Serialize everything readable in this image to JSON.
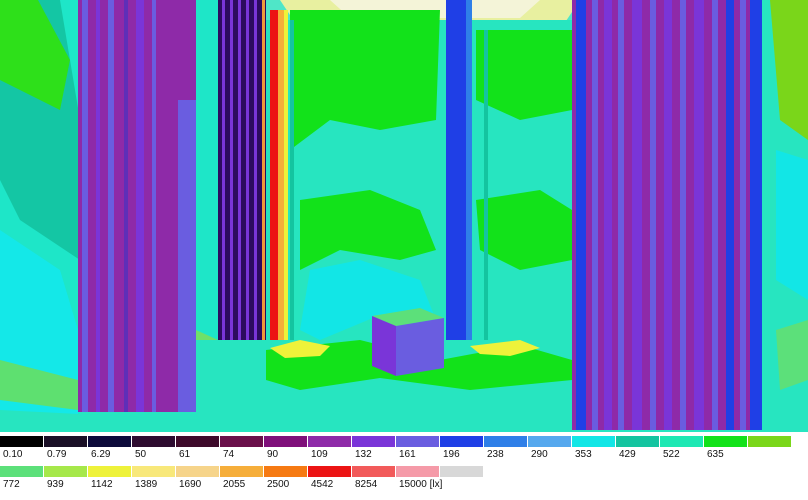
{
  "legend": {
    "row1": [
      {
        "label": "0.10",
        "color": "#000000"
      },
      {
        "label": "0.79",
        "color": "#1a0f26"
      },
      {
        "label": "6.29",
        "color": "#0c0a3a"
      },
      {
        "label": "50",
        "color": "#2d0b2f"
      },
      {
        "label": "61",
        "color": "#3e0a2a"
      },
      {
        "label": "74",
        "color": "#6a0f4a"
      },
      {
        "label": "90",
        "color": "#7f0f7a"
      },
      {
        "label": "109",
        "color": "#8e2aa8"
      },
      {
        "label": "132",
        "color": "#7a35d8"
      },
      {
        "label": "161",
        "color": "#6a5de0"
      },
      {
        "label": "196",
        "color": "#1f3fe6"
      },
      {
        "label": "238",
        "color": "#2f7fe8"
      },
      {
        "label": "290",
        "color": "#55a8ee"
      },
      {
        "label": "353",
        "color": "#12e6e6"
      },
      {
        "label": "429",
        "color": "#14c4a0"
      },
      {
        "label": "522",
        "color": "#1ee8b4"
      },
      {
        "label": "635",
        "color": "#12e21a"
      },
      {
        "label": "",
        "color": "#7ad61a"
      }
    ],
    "row2": [
      {
        "label": "772",
        "color": "#5ce07a"
      },
      {
        "label": "939",
        "color": "#a6e84a"
      },
      {
        "label": "1142",
        "color": "#eef23a"
      },
      {
        "label": "1389",
        "color": "#f8e87a"
      },
      {
        "label": "1690",
        "color": "#f6d48a"
      },
      {
        "label": "2055",
        "color": "#f6ae3a"
      },
      {
        "label": "2500",
        "color": "#f67a12"
      },
      {
        "label": "4542",
        "color": "#ec1414"
      },
      {
        "label": "8254",
        "color": "#f25a5a"
      },
      {
        "label": "15000 [lx]",
        "color": "#f59aa8"
      },
      {
        "label": "",
        "color": "#d8d8d8"
      }
    ]
  }
}
